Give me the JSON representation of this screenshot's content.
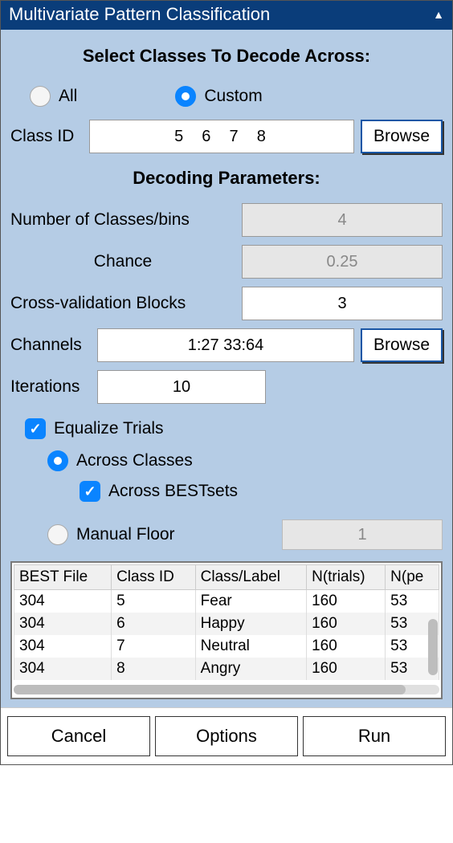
{
  "window": {
    "title": "Multivariate Pattern Classification"
  },
  "classes_section": {
    "heading": "Select Classes To Decode Across:",
    "radio_all": "All",
    "radio_custom": "Custom",
    "class_id_label": "Class ID",
    "class_id_value": "5  6  7  8",
    "browse": "Browse"
  },
  "params": {
    "heading": "Decoding Parameters:",
    "num_classes_label": "Number of Classes/bins",
    "num_classes_value": "4",
    "chance_label": "Chance",
    "chance_value": "0.25",
    "cv_label": "Cross-validation Blocks",
    "cv_value": "3",
    "channels_label": "Channels",
    "channels_value": "1:27 33:64",
    "channels_browse": "Browse",
    "iterations_label": "Iterations",
    "iterations_value": "10"
  },
  "equalize": {
    "label": "Equalize Trials",
    "across_classes": "Across Classes",
    "across_bestsets": "Across BESTsets",
    "manual_floor": "Manual Floor",
    "manual_value": "1"
  },
  "table": {
    "headers": [
      "BEST File",
      "Class ID",
      "Class/Label",
      "N(trials)",
      "N(pe"
    ],
    "rows": [
      [
        "304",
        "5",
        "Fear",
        "160",
        "53"
      ],
      [
        "304",
        "6",
        "Happy",
        "160",
        "53"
      ],
      [
        "304",
        "7",
        "Neutral",
        "160",
        "53"
      ],
      [
        "304",
        "8",
        "Angry",
        "160",
        "53"
      ]
    ]
  },
  "buttons": {
    "cancel": "Cancel",
    "options": "Options",
    "run": "Run"
  }
}
